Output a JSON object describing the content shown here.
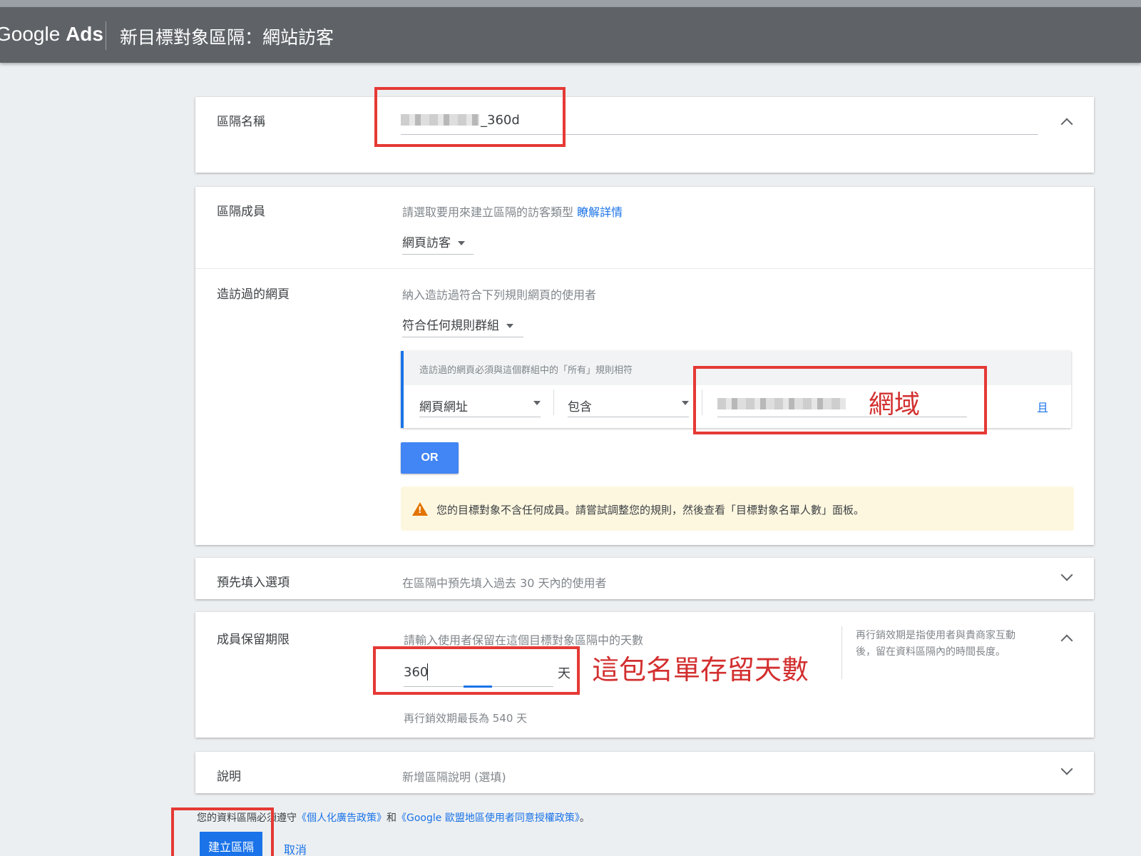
{
  "header": {
    "logo_google": "Google",
    "logo_ads": "Ads",
    "title": "新目標對象區隔：網站訪客"
  },
  "segment_name": {
    "label": "區隔名稱",
    "value_suffix": "_360d"
  },
  "members": {
    "label": "區隔成員",
    "hint": "請選取要用來建立區隔的訪客類型",
    "learn_more": "瞭解詳情",
    "selected": "網頁訪客"
  },
  "visited_pages": {
    "label": "造訪過的網頁",
    "hint": "納入造訪過符合下列規則網頁的使用者",
    "group_mode": "符合任何規則群組",
    "rule_group_note": "造訪過的網頁必須與這個群組中的「所有」規則相符",
    "rule_field": "網頁網址",
    "rule_operator": "包含",
    "and_label": "且",
    "or_button": "OR",
    "warning": "您的目標對象不含任何成員。請嘗試調整您的規則，然後查看「目標對象名單人數」面板。"
  },
  "prefill": {
    "label": "預先填入選項",
    "text": "在區隔中預先填入過去 30 天內的使用者"
  },
  "duration": {
    "label": "成員保留期限",
    "hint": "請輸入使用者保留在這個目標對象區隔中的天數",
    "value": "360",
    "unit": "天",
    "max_note": "再行銷效期最長為 540 天",
    "side_note": "再行銷效期是指使用者與貴商家互動後，留在資料區隔內的時間長度。"
  },
  "description": {
    "label": "說明",
    "placeholder": "新增區隔說明 (選填)"
  },
  "footer": {
    "policy_prefix": "您的資料區隔必須遵守",
    "policy_link1": "《個人化廣告政策》",
    "policy_and": "和",
    "policy_link2": "《Google 歐盟地區使用者同意授權政策》",
    "policy_suffix": "。",
    "create_button": "建立區隔",
    "cancel": "取消"
  },
  "annotations": {
    "domain": "網域",
    "retention": "這包名單存留天數"
  },
  "colors": {
    "header_bg": "#5f6368",
    "accent_blue": "#1a73e8",
    "annotation_red": "#e53935",
    "warning_bg": "#fef7e0"
  }
}
